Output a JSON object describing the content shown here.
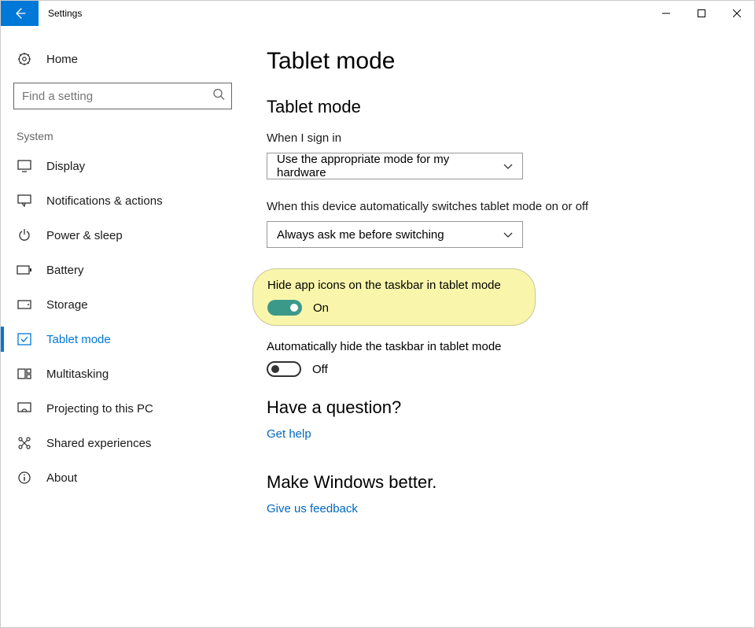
{
  "window": {
    "title": "Settings"
  },
  "sidebar": {
    "home_label": "Home",
    "search_placeholder": "Find a setting",
    "section_label": "System",
    "items": [
      {
        "id": "display",
        "label": "Display"
      },
      {
        "id": "notifications",
        "label": "Notifications & actions"
      },
      {
        "id": "power-sleep",
        "label": "Power & sleep"
      },
      {
        "id": "battery",
        "label": "Battery"
      },
      {
        "id": "storage",
        "label": "Storage"
      },
      {
        "id": "tablet-mode",
        "label": "Tablet mode",
        "active": true
      },
      {
        "id": "multitasking",
        "label": "Multitasking"
      },
      {
        "id": "projecting",
        "label": "Projecting to this PC"
      },
      {
        "id": "shared-experiences",
        "label": "Shared experiences"
      },
      {
        "id": "about",
        "label": "About"
      }
    ]
  },
  "main": {
    "page_title": "Tablet mode",
    "subheading": "Tablet mode",
    "sign_in": {
      "label": "When I sign in",
      "value": "Use the appropriate mode for my hardware"
    },
    "auto_switch": {
      "label": "When this device automatically switches tablet mode on or off",
      "value": "Always ask me before switching"
    },
    "hide_icons": {
      "label": "Hide app icons on the taskbar in tablet mode",
      "state_text": "On",
      "on": true,
      "highlighted": true
    },
    "auto_hide_taskbar": {
      "label": "Automatically hide the taskbar in tablet mode",
      "state_text": "Off",
      "on": false
    },
    "question_heading": "Have a question?",
    "get_help_link": "Get help",
    "better_heading": "Make Windows better.",
    "feedback_link": "Give us feedback"
  }
}
